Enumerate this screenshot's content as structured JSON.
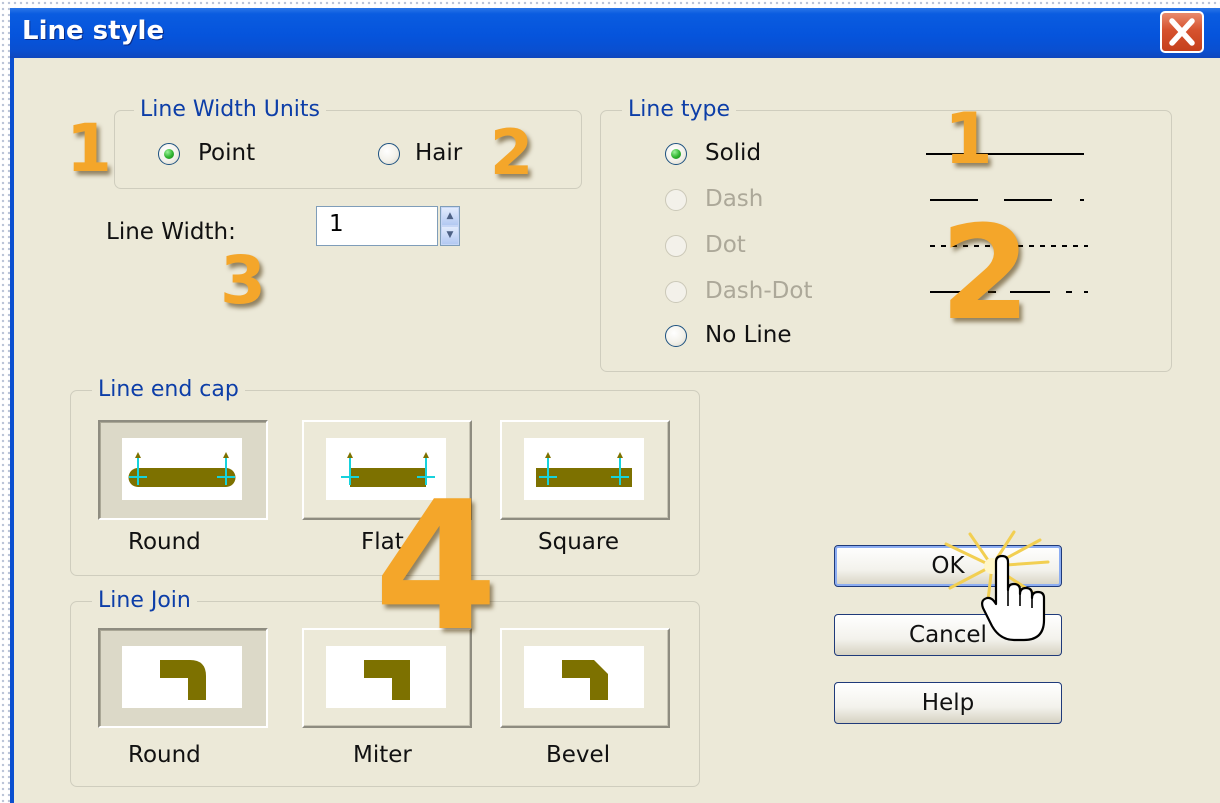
{
  "window": {
    "title": "Line style"
  },
  "line_width_units": {
    "legend": "Line Width Units",
    "options": [
      {
        "label": "Point",
        "selected": true
      },
      {
        "label": "Hair",
        "selected": false
      }
    ]
  },
  "line_width": {
    "label": "Line Width:",
    "value": "1"
  },
  "line_type": {
    "legend": "Line type",
    "options": [
      {
        "label": "Solid",
        "selected": true,
        "enabled": true
      },
      {
        "label": "Dash",
        "selected": false,
        "enabled": false
      },
      {
        "label": "Dot",
        "selected": false,
        "enabled": false
      },
      {
        "label": "Dash-Dot",
        "selected": false,
        "enabled": false
      },
      {
        "label": "No Line",
        "selected": false,
        "enabled": true
      }
    ]
  },
  "line_end_cap": {
    "legend": "Line end cap",
    "options": [
      {
        "label": "Round",
        "pressed": true
      },
      {
        "label": "Flat",
        "pressed": false
      },
      {
        "label": "Square",
        "pressed": false
      }
    ]
  },
  "line_join": {
    "legend": "Line Join",
    "options": [
      {
        "label": "Round",
        "pressed": true
      },
      {
        "label": "Miter",
        "pressed": false
      },
      {
        "label": "Bevel",
        "pressed": false
      }
    ]
  },
  "buttons": {
    "ok": "OK",
    "cancel": "Cancel",
    "help": "Help"
  },
  "annotations": {
    "units_1": "1",
    "units_2": "2",
    "width_3": "3",
    "type_1": "1",
    "type_2": "2",
    "caps_4": "4"
  },
  "colors": {
    "titlebar": "#0554dc",
    "dialog_bg": "#ece9d8",
    "group_legend": "#0d3ea8",
    "annotation": "#f4a62a",
    "glyph": "#7d7100",
    "guide": "#16d2dc",
    "radio_selected": "#2fb42f"
  },
  "icons": {
    "close": "close-x-icon",
    "cursor": "hand-pointer-icon"
  }
}
